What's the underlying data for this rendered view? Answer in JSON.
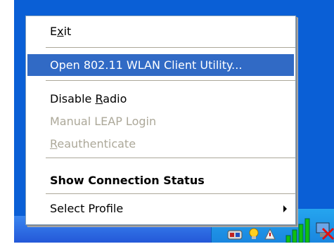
{
  "menu": {
    "exit": {
      "prefix": "E",
      "accel": "x",
      "suffix": "it"
    },
    "open_utility": {
      "label": "Open 802.11 WLAN Client Utility..."
    },
    "disable_radio": {
      "prefix": "Disable ",
      "accel": "R",
      "suffix": "adio"
    },
    "manual_leap_login": {
      "label": "Manual LEAP Login"
    },
    "reauthenticate": {
      "prefix": "",
      "accel": "R",
      "suffix": "eauthenticate"
    },
    "show_connection_status": {
      "label": "Show Connection Status"
    },
    "select_profile": {
      "label": "Select Profile"
    }
  },
  "colors": {
    "highlight": "#316ac5",
    "disabled_text": "#aca899",
    "desktop": "#0a5fd6",
    "tray": "#1a86df"
  },
  "tray_icons": [
    "shield-icon",
    "bulb-icon",
    "alert-icon",
    "signal-strength-icon",
    "network-disconnected-icon"
  ]
}
